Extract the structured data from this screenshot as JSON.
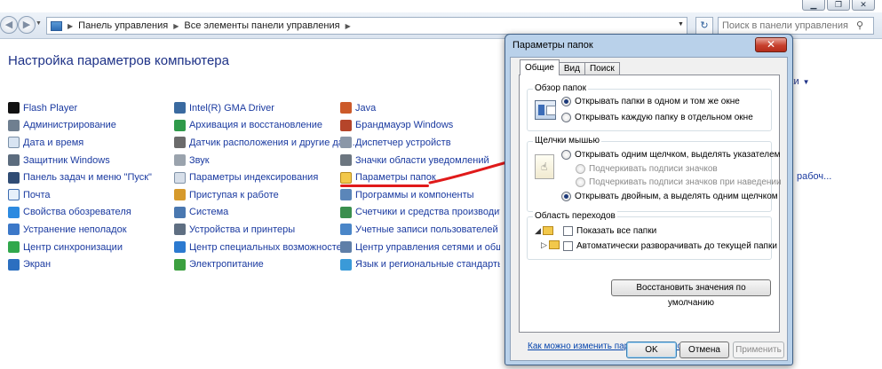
{
  "window": {
    "ctrl_min": "▁",
    "ctrl_max": "❐",
    "ctrl_close": "✕"
  },
  "addressbar": {
    "crumbs": [
      "Панель управления",
      "Все элементы панели управления"
    ],
    "search_placeholder": "Поиск в панели управления"
  },
  "main": {
    "title": "Настройка параметров компьютера",
    "view_label": "начки",
    "col1": [
      "Flash Player",
      "Администрирование",
      "Дата и время",
      "Защитник Windows",
      "Панель задач и меню \"Пуск\"",
      "Почта",
      "Свойства обозревателя",
      "Устранение неполадок",
      "Центр синхронизации",
      "Экран"
    ],
    "col2": [
      "Intel(R) GMA Driver",
      "Архивация и восстановление",
      "Датчик расположения и другие дат...",
      "Звук",
      "Параметры индексирования",
      "Приступая к работе",
      "Система",
      "Устройства и принтеры",
      "Центр специальных возможностей",
      "Электропитание"
    ],
    "col3": [
      "Java",
      "Брандмауэр Windows",
      "Диспетчер устройств",
      "Значки области уведомлений",
      "Параметры папок",
      "Программы и компоненты",
      "Счетчики и средства производител...",
      "Учетные записи пользователей",
      "Центр управления сетями и общи...",
      "Язык и региональные стандарты"
    ],
    "col_far_partial": "рабоч..."
  },
  "dialog": {
    "title": "Параметры папок",
    "close": "✕",
    "tabs": [
      "Общие",
      "Вид",
      "Поиск"
    ],
    "group_browse": {
      "title": "Обзор папок",
      "opt1": "Открывать папки в одном и том же окне",
      "opt2": "Открывать каждую папку в отдельном окне"
    },
    "group_click": {
      "title": "Щелчки мышью",
      "opt1": "Открывать одним щелчком, выделять указателем",
      "sub1": "Подчеркивать подписи значков",
      "sub2": "Подчеркивать подписи значков при наведении",
      "opt2": "Открывать двойным, а выделять одним щелчком"
    },
    "group_nav": {
      "title": "Область переходов",
      "chk1": "Показать все папки",
      "chk2": "Автоматически разворачивать до текущей папки"
    },
    "restore_button": "Восстановить значения по умолчанию",
    "help_link": "Как можно изменить параметры папок?",
    "ok": "OK",
    "cancel": "Отмена",
    "apply": "Применить"
  },
  "colors": {
    "link_blue": "#1a3aa0",
    "title_blue": "#1e3287",
    "annotation_red": "#e01a1a"
  }
}
